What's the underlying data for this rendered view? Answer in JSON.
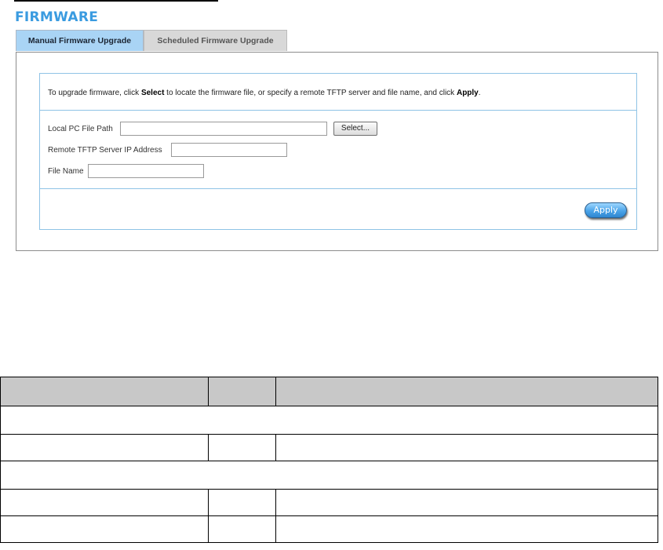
{
  "page": {
    "title": "FIRMWARE"
  },
  "tabs": [
    {
      "label": "Manual Firmware Upgrade",
      "active": true
    },
    {
      "label": "Scheduled Firmware Upgrade",
      "active": false
    }
  ],
  "instructions": {
    "part1": "To upgrade firmware, click ",
    "bold1": "Select",
    "part2": " to locate the firmware file, or specify a remote TFTP server and file name, and click ",
    "bold2": "Apply",
    "part3": "."
  },
  "form": {
    "local_path_label": "Local PC File Path",
    "local_path_value": "",
    "select_label": "Select...",
    "tftp_label": "Remote TFTP Server IP Address",
    "tftp_value": "",
    "file_name_label": "File Name",
    "file_name_value": ""
  },
  "actions": {
    "apply_label": "Apply"
  },
  "colors": {
    "title": "#3a9be0",
    "active_tab": "#a9d4f5",
    "inactive_tab": "#d8d8d8",
    "inner_border": "#8fc3e6",
    "apply_button": "#4aa3e8",
    "table_header": "#c8c8c8"
  }
}
